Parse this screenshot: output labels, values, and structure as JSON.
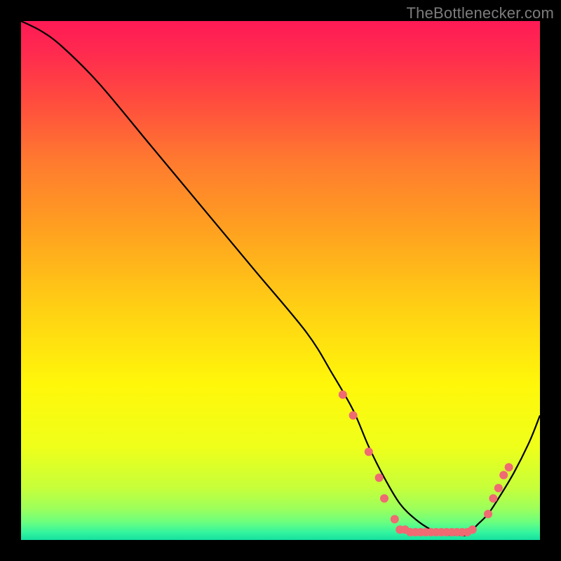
{
  "watermark": "TheBottlenecker.com",
  "chart_data": {
    "type": "line",
    "title": "",
    "xlabel": "",
    "ylabel": "",
    "xlim": [
      0,
      100
    ],
    "ylim": [
      0,
      100
    ],
    "background_gradient_stops": [
      {
        "offset": 0.0,
        "color": "#ff1a55"
      },
      {
        "offset": 0.06,
        "color": "#ff2a4f"
      },
      {
        "offset": 0.15,
        "color": "#ff4a3f"
      },
      {
        "offset": 0.27,
        "color": "#ff7a2f"
      },
      {
        "offset": 0.4,
        "color": "#ffa020"
      },
      {
        "offset": 0.55,
        "color": "#ffcf14"
      },
      {
        "offset": 0.7,
        "color": "#fff70a"
      },
      {
        "offset": 0.82,
        "color": "#efff1a"
      },
      {
        "offset": 0.9,
        "color": "#c6ff3a"
      },
      {
        "offset": 0.94,
        "color": "#9cff5c"
      },
      {
        "offset": 0.965,
        "color": "#6cff7e"
      },
      {
        "offset": 0.985,
        "color": "#35f59e"
      },
      {
        "offset": 1.0,
        "color": "#14e0a0"
      }
    ],
    "series": [
      {
        "name": "bottleneck-curve",
        "x": [
          0,
          4,
          8,
          15,
          25,
          35,
          45,
          55,
          60,
          64,
          67,
          70,
          73,
          76,
          79,
          82,
          84,
          86,
          88,
          90,
          92,
          95,
          98,
          100
        ],
        "y": [
          100,
          98,
          95,
          88,
          76,
          64,
          52,
          40,
          32,
          25,
          18,
          12,
          7,
          4,
          2,
          1,
          1,
          1,
          3,
          5,
          8,
          13,
          19,
          24
        ]
      }
    ],
    "markers": {
      "name": "highlight-dots",
      "color": "#ef6a72",
      "radius_px": 6,
      "points": [
        {
          "x": 62,
          "y": 28
        },
        {
          "x": 64,
          "y": 24
        },
        {
          "x": 67,
          "y": 17
        },
        {
          "x": 69,
          "y": 12
        },
        {
          "x": 70,
          "y": 8
        },
        {
          "x": 72,
          "y": 4
        },
        {
          "x": 73,
          "y": 2
        },
        {
          "x": 74,
          "y": 2
        },
        {
          "x": 75,
          "y": 1.5
        },
        {
          "x": 76,
          "y": 1.5
        },
        {
          "x": 77,
          "y": 1.5
        },
        {
          "x": 78,
          "y": 1.5
        },
        {
          "x": 79,
          "y": 1.5
        },
        {
          "x": 80,
          "y": 1.5
        },
        {
          "x": 81,
          "y": 1.5
        },
        {
          "x": 82,
          "y": 1.5
        },
        {
          "x": 83,
          "y": 1.5
        },
        {
          "x": 84,
          "y": 1.5
        },
        {
          "x": 85,
          "y": 1.5
        },
        {
          "x": 86,
          "y": 1.5
        },
        {
          "x": 87,
          "y": 2
        },
        {
          "x": 90,
          "y": 5
        },
        {
          "x": 91,
          "y": 8
        },
        {
          "x": 92,
          "y": 10
        },
        {
          "x": 93,
          "y": 12.5
        },
        {
          "x": 94,
          "y": 14
        }
      ]
    }
  }
}
